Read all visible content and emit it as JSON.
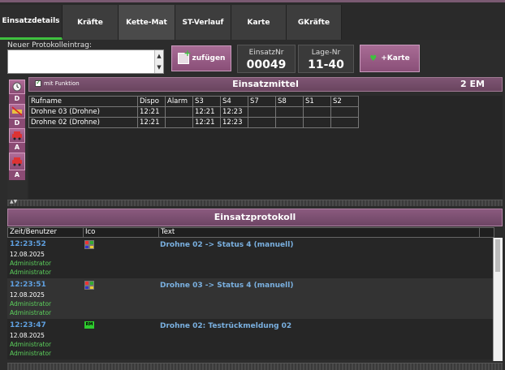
{
  "tabs": [
    {
      "label": "Einsatzdetails",
      "active": true
    },
    {
      "label": "Kräfte"
    },
    {
      "label": "Kette-Mat"
    },
    {
      "label": "ST-Verlauf"
    },
    {
      "label": "Karte"
    },
    {
      "label": "GKräfte"
    }
  ],
  "protokoll_entry": {
    "label": "Neuer Protokolleintrag:",
    "value": ""
  },
  "buttons": {
    "zufuegen": "zufügen",
    "karte": "+Karte"
  },
  "einsatz": {
    "nr_label": "EinsatzNr",
    "nr_value": "00049",
    "lage_label": "Lage-Nr",
    "lage_value": "11-40"
  },
  "einsatzmittel": {
    "checkbox_label": "mit Funktion",
    "title": "Einsatzmittel",
    "count": "2 EM",
    "side_letters": [
      "D",
      "D",
      "A",
      "A"
    ],
    "columns": [
      "Rufname",
      "Dispo",
      "Alarm",
      "S3",
      "S4",
      "S7",
      "S8",
      "S1",
      "S2"
    ],
    "rows": [
      [
        "Drohne 03 (Drohne)",
        "12:21",
        "",
        "12:21",
        "12:23",
        "",
        "",
        "",
        ""
      ],
      [
        "Drohne 02 (Drohne)",
        "12:21",
        "",
        "12:21",
        "12:23",
        "",
        "",
        "",
        ""
      ]
    ]
  },
  "einsatzprotokoll": {
    "title": "Einsatzprotokoll",
    "columns": [
      "Zeit/Benutzer",
      "Ico",
      "Text"
    ],
    "entries": [
      {
        "time": "12:23:52",
        "date": "12.08.2025",
        "user1": "Administrator",
        "user2": "Administrator",
        "icon": "status-icon",
        "text": "Drohne 02 -> Status 4 (manuell)"
      },
      {
        "time": "12:23:51",
        "date": "12.08.2025",
        "user1": "Administrator",
        "user2": "Administrator",
        "icon": "status-icon",
        "text": "Drohne 03 -> Status 4 (manuell)"
      },
      {
        "time": "12:23:47",
        "date": "12.08.2025",
        "user1": "Administrator",
        "user2": "Administrator",
        "icon": "rm-icon",
        "icon_text": "RM",
        "text": "Drohne 02: Testrückmeldung 02"
      }
    ]
  }
}
